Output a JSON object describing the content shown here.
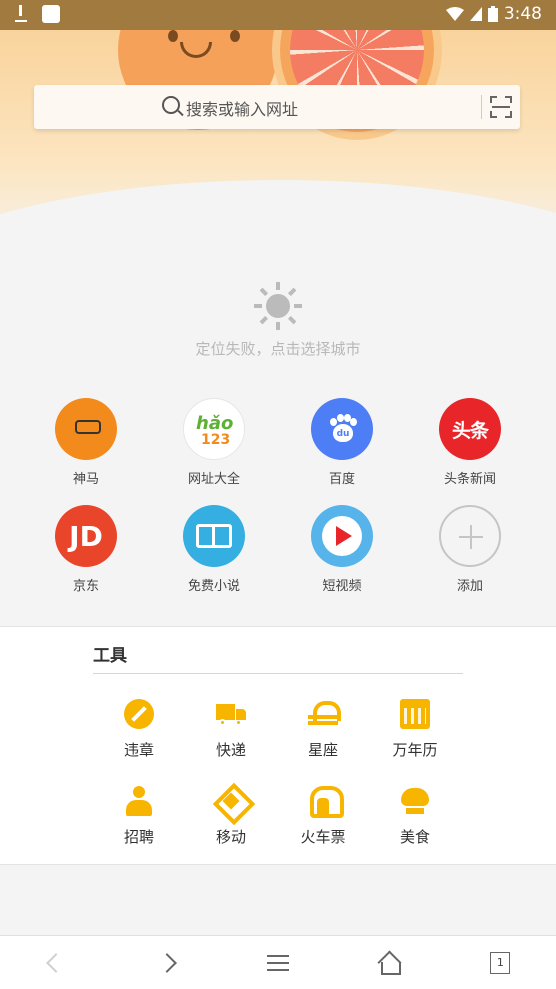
{
  "status_bar": {
    "time": "3:48"
  },
  "search": {
    "placeholder": "搜索或输入网址"
  },
  "weather": {
    "message": "定位失败，点击选择城市"
  },
  "shortcuts": [
    {
      "label": "神马",
      "icon": "shenma-llama-icon"
    },
    {
      "label": "网址大全",
      "icon": "hao123-icon",
      "icon_text_top": "hǎo",
      "icon_text_bottom": "123"
    },
    {
      "label": "百度",
      "icon": "baidu-paw-icon",
      "icon_text": "du"
    },
    {
      "label": "头条新闻",
      "icon": "toutiao-icon",
      "icon_text": "头条"
    },
    {
      "label": "京东",
      "icon": "jd-icon",
      "icon_text": "JD"
    },
    {
      "label": "免费小说",
      "icon": "book-icon"
    },
    {
      "label": "短视频",
      "icon": "play-icon"
    },
    {
      "label": "添加",
      "icon": "plus-icon"
    }
  ],
  "tools": {
    "title": "工具",
    "items": [
      {
        "label": "违章",
        "icon": "no-entry-icon"
      },
      {
        "label": "快递",
        "icon": "truck-icon"
      },
      {
        "label": "星座",
        "icon": "libra-icon"
      },
      {
        "label": "万年历",
        "icon": "calendar-icon"
      },
      {
        "label": "招聘",
        "icon": "person-icon"
      },
      {
        "label": "移动",
        "icon": "china-mobile-icon"
      },
      {
        "label": "火车票",
        "icon": "train-icon"
      },
      {
        "label": "美食",
        "icon": "chef-hat-icon"
      }
    ]
  },
  "bottom_nav": {
    "tab_count": "1"
  },
  "colors": {
    "accent": "#f7b500",
    "header_top": "#f9d39c",
    "background": "#f4f4f4"
  }
}
